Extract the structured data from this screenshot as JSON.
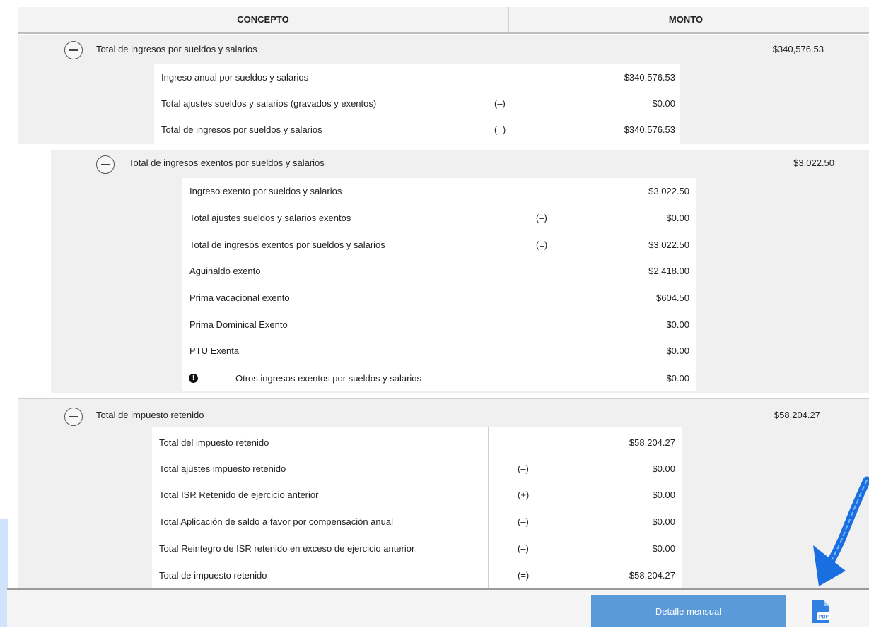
{
  "header": {
    "concepto": "CONCEPTO",
    "monto": "MONTO"
  },
  "section1": {
    "title": "Total de ingresos por sueldos y salarios",
    "total": "$340,576.53",
    "rows": [
      {
        "label": "Ingreso anual por sueldos y salarios",
        "op": "",
        "value": "$340,576.53"
      },
      {
        "label": "Total ajustes sueldos y salarios (gravados y exentos)",
        "op": "(–)",
        "value": "$0.00"
      },
      {
        "label": "Total de ingresos por sueldos y salarios",
        "op": "(=)",
        "value": "$340,576.53"
      }
    ]
  },
  "section2": {
    "title": "Total de ingresos exentos por sueldos y salarios",
    "total": "$3,022.50",
    "rows": [
      {
        "label": "Ingreso exento por sueldos y salarios",
        "op": "",
        "value": "$3,022.50"
      },
      {
        "label": "Total ajustes sueldos y salarios exentos",
        "op": "(–)",
        "value": "$0.00"
      },
      {
        "label": "Total de ingresos exentos por sueldos y salarios",
        "op": "(=)",
        "value": "$3,022.50"
      },
      {
        "label": "Aguinaldo exento",
        "op": "",
        "value": "$2,418.00"
      },
      {
        "label": "Prima vacacional exento",
        "op": "",
        "value": "$604.50"
      },
      {
        "label": "Prima Dominical Exento",
        "op": "",
        "value": "$0.00"
      },
      {
        "label": "PTU Exenta",
        "op": "",
        "value": "$0.00"
      }
    ],
    "extra": {
      "label": "Otros ingresos exentos por sueldos y salarios",
      "value": "$0.00"
    }
  },
  "section3": {
    "title": "Total de impuesto retenido",
    "total": "$58,204.27",
    "rows": [
      {
        "label": "Total del impuesto retenido",
        "op": "",
        "value": "$58,204.27"
      },
      {
        "label": "Total ajustes impuesto retenido",
        "op": "(–)",
        "value": "$0.00"
      },
      {
        "label": "Total ISR Retenido de ejercicio anterior",
        "op": "(+)",
        "value": "$0.00"
      },
      {
        "label": "Total Aplicación de saldo a favor por compensación anual",
        "op": "(–)",
        "value": "$0.00"
      },
      {
        "label": "Total Reintegro de ISR retenido en exceso de ejercicio anterior",
        "op": "(–)",
        "value": "$0.00"
      },
      {
        "label": "Total de impuesto retenido",
        "op": "(=)",
        "value": "$58,204.27"
      }
    ]
  },
  "footer": {
    "detalle_label": "Detalle mensual",
    "pdf_label": "PDF"
  },
  "colors": {
    "button": "#5b9ad8",
    "arrow": "#1a6fe0",
    "row_gray": "#f0f0f0"
  }
}
